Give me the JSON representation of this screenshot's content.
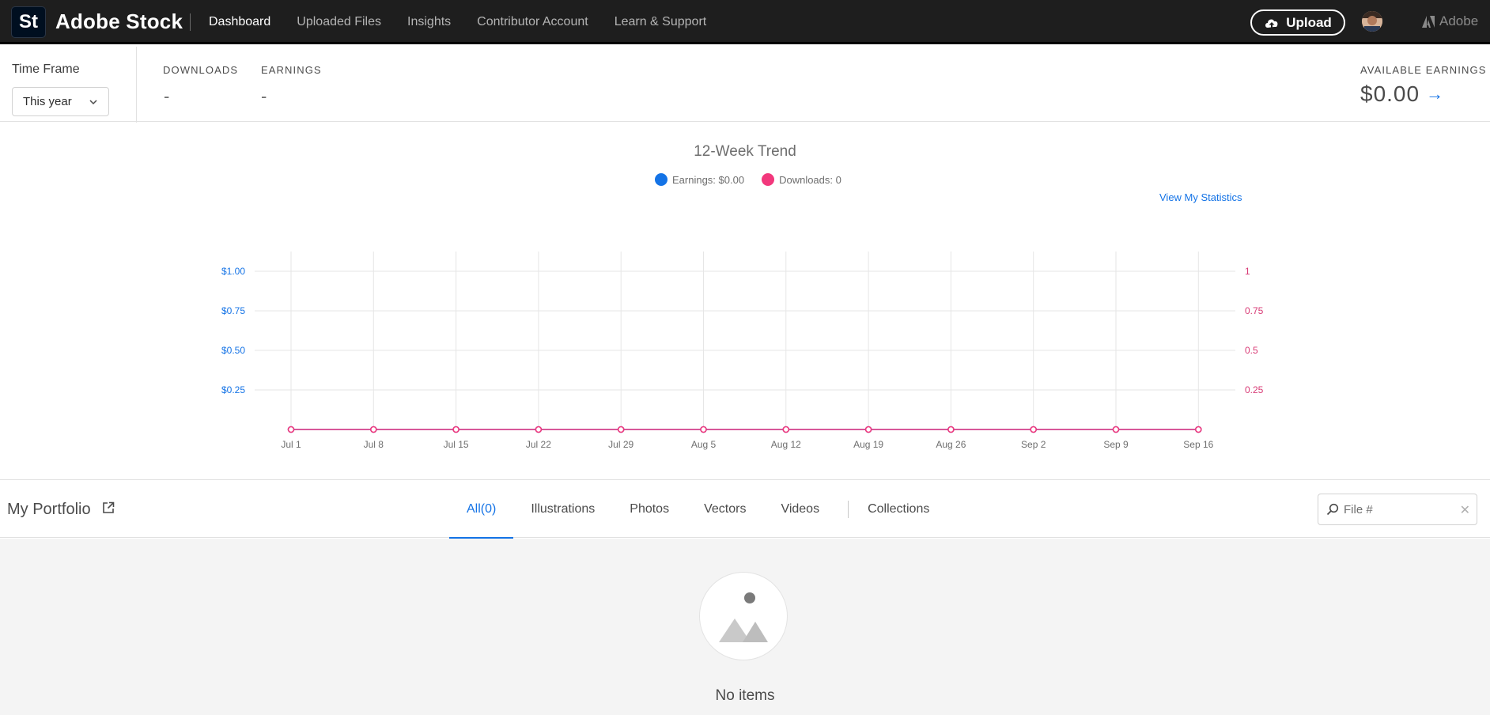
{
  "app": {
    "badge": "St",
    "name": "Adobe Stock",
    "adobe_label": "Adobe"
  },
  "nav": {
    "items": [
      {
        "label": "Dashboard",
        "active": true
      },
      {
        "label": "Uploaded Files",
        "active": false
      },
      {
        "label": "Insights",
        "active": false
      },
      {
        "label": "Contributor Account",
        "active": false
      },
      {
        "label": "Learn & Support",
        "active": false
      }
    ],
    "upload_label": "Upload"
  },
  "stats": {
    "timeframe_label": "Time Frame",
    "timeframe_value": "This year",
    "downloads_label": "DOWNLOADS",
    "downloads_value": "-",
    "earnings_label": "EARNINGS",
    "earnings_value": "-",
    "available_label": "AVAILABLE EARNINGS",
    "available_value": "$0.00"
  },
  "trend": {
    "view_stats_label": "View My Statistics"
  },
  "chart_data": {
    "type": "line",
    "title": "12-Week Trend",
    "categories": [
      "Jul 1",
      "Jul 8",
      "Jul 15",
      "Jul 22",
      "Jul 29",
      "Aug 5",
      "Aug 12",
      "Aug 19",
      "Aug 26",
      "Sep 2",
      "Sep 9",
      "Sep 16"
    ],
    "series": [
      {
        "name": "Earnings: $0.00",
        "axis": "left",
        "color": "#1473e6",
        "values": [
          0,
          0,
          0,
          0,
          0,
          0,
          0,
          0,
          0,
          0,
          0,
          0
        ]
      },
      {
        "name": "Downloads: 0",
        "axis": "right",
        "color": "#f2387c",
        "values": [
          0,
          0,
          0,
          0,
          0,
          0,
          0,
          0,
          0,
          0,
          0,
          0
        ]
      }
    ],
    "left_axis": {
      "ticks": [
        "$0.25",
        "$0.50",
        "$0.75",
        "$1.00"
      ],
      "tick_values": [
        0.25,
        0.5,
        0.75,
        1.0
      ],
      "ylim": [
        0,
        1
      ],
      "color": "#1473e6"
    },
    "right_axis": {
      "ticks": [
        "0.25",
        "0.5",
        "0.75",
        "1"
      ],
      "tick_values": [
        0.25,
        0.5,
        0.75,
        1.0
      ],
      "ylim": [
        0,
        1
      ],
      "color": "#d83a75"
    },
    "grid": true,
    "legend": "top-center"
  },
  "portfolio": {
    "title": "My Portfolio",
    "tabs": [
      {
        "label": "All(0)",
        "active": true
      },
      {
        "label": "Illustrations",
        "active": false
      },
      {
        "label": "Photos",
        "active": false
      },
      {
        "label": "Vectors",
        "active": false
      },
      {
        "label": "Videos",
        "active": false
      },
      {
        "label": "Collections",
        "active": false
      }
    ],
    "search_placeholder": "File #",
    "empty_text": "No items"
  }
}
